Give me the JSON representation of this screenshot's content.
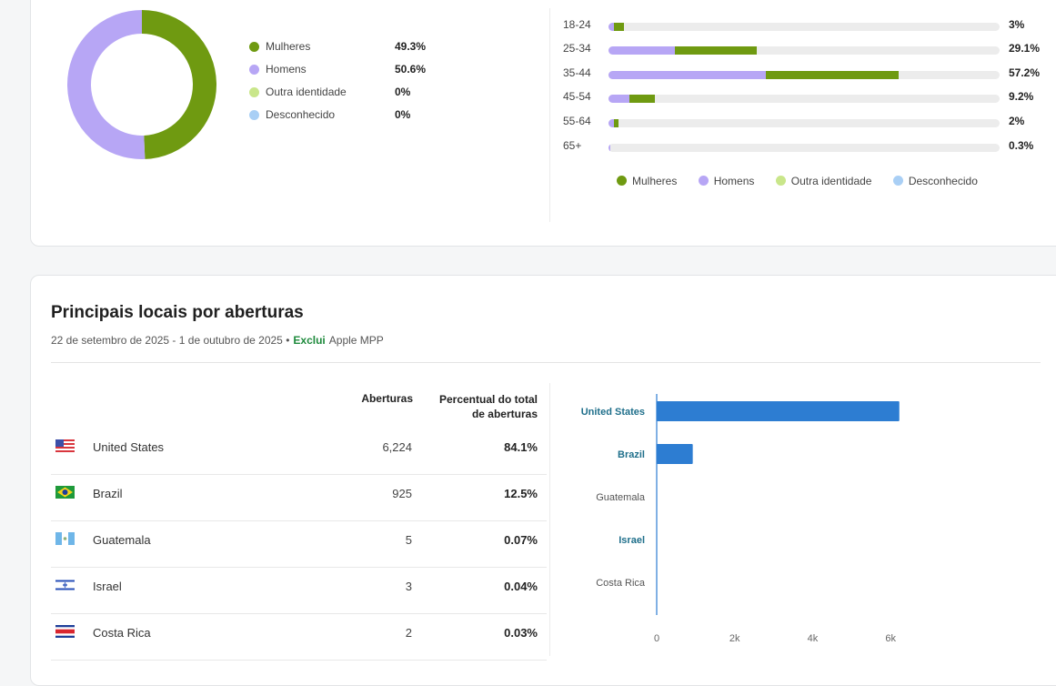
{
  "colors": {
    "women": "#6f9a11",
    "men": "#b7a6f5",
    "other": "#c9e68a",
    "unknown": "#a9cff5",
    "bar": "#2d7dd2",
    "link": "#1f6f8b"
  },
  "gender": {
    "items": [
      {
        "label": "Mulheres",
        "value": "49.3%"
      },
      {
        "label": "Homens",
        "value": "50.6%"
      },
      {
        "label": "Outra identidade",
        "value": "0%"
      },
      {
        "label": "Desconhecido",
        "value": "0%"
      }
    ],
    "chart_data": {
      "type": "pie",
      "labels": [
        "Mulheres",
        "Homens",
        "Outra identidade",
        "Desconhecido"
      ],
      "values": [
        49.3,
        50.6,
        0,
        0
      ]
    }
  },
  "age": {
    "rows": [
      {
        "label": "18-24",
        "total": "3%",
        "men": 1,
        "women": 2
      },
      {
        "label": "25-34",
        "total": "29.1%",
        "men": 13,
        "women": 16.1
      },
      {
        "label": "35-44",
        "total": "57.2%",
        "men": 31,
        "women": 26.2
      },
      {
        "label": "45-54",
        "total": "9.2%",
        "men": 4.2,
        "women": 5
      },
      {
        "label": "55-64",
        "total": "2%",
        "men": 1,
        "women": 1
      },
      {
        "label": "65+",
        "total": "0.3%",
        "men": 0.3,
        "women": 0
      }
    ],
    "legend": [
      "Mulheres",
      "Homens",
      "Outra identidade",
      "Desconhecido"
    ]
  },
  "locations": {
    "title": "Principais locais por aberturas",
    "date_range": "22 de setembro de 2025 - 1 de outubro de 2025 •",
    "exclude_label": "Exclui",
    "exclude_value": "Apple MPP",
    "col_opens": "Aberturas",
    "col_pct_line1": "Percentual do total",
    "col_pct_line2": "de aberturas",
    "rows": [
      {
        "country": "United States",
        "opens": "6,224",
        "pct": "84.1%"
      },
      {
        "country": "Brazil",
        "opens": "925",
        "pct": "12.5%"
      },
      {
        "country": "Guatemala",
        "opens": "5",
        "pct": "0.07%"
      },
      {
        "country": "Israel",
        "opens": "3",
        "pct": "0.04%"
      },
      {
        "country": "Costa Rica",
        "opens": "2",
        "pct": "0.03%"
      }
    ]
  },
  "chart_data": {
    "type": "bar",
    "orientation": "horizontal",
    "categories": [
      "United States",
      "Brazil",
      "Guatemala",
      "Israel",
      "Costa Rica"
    ],
    "values": [
      6224,
      925,
      5,
      3,
      2
    ],
    "highlighted": [
      "United States",
      "Brazil",
      "Israel"
    ],
    "xlim": [
      0,
      7000
    ],
    "xticks": [
      "0",
      "2k",
      "4k",
      "6k"
    ],
    "xtick_values": [
      0,
      2000,
      4000,
      6000
    ]
  }
}
